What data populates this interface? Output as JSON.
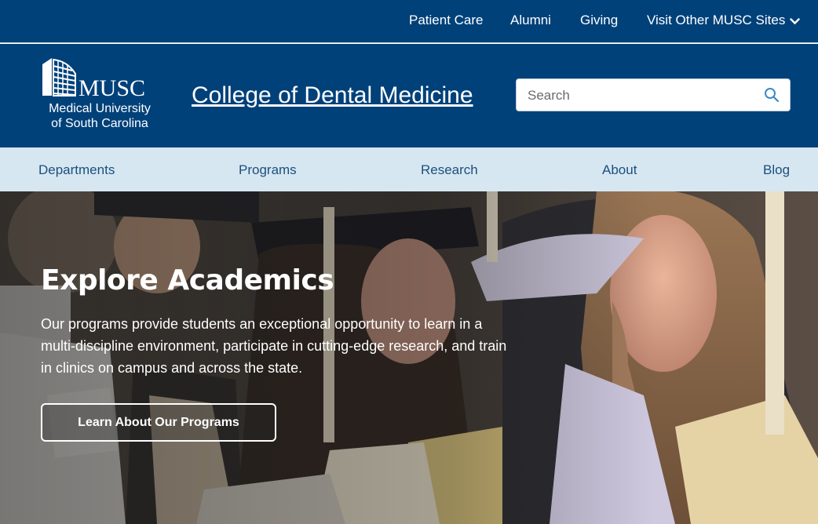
{
  "utility_nav": {
    "items": [
      {
        "label": "Patient Care"
      },
      {
        "label": "Alumni"
      },
      {
        "label": "Giving"
      },
      {
        "label": "Visit Other MUSC Sites"
      }
    ]
  },
  "header": {
    "logo": {
      "wordmark": "MUSC",
      "line1": "Medical University",
      "line2": "of South Carolina"
    },
    "site_title": "College of Dental Medicine",
    "search": {
      "placeholder": "Search",
      "value": ""
    }
  },
  "main_nav": {
    "items": [
      {
        "label": "Departments"
      },
      {
        "label": "Programs"
      },
      {
        "label": "Research"
      },
      {
        "label": "About"
      },
      {
        "label": "Blog"
      }
    ]
  },
  "hero": {
    "title": "Explore Academics",
    "text": "Our programs provide students an exceptional opportunity to learn in a multi-discipline environment, participate in cutting-edge research, and train in clinics on campus and across the state.",
    "cta_label": "Learn About Our Programs"
  },
  "colors": {
    "primary_blue": "#00417a",
    "nav_background": "#d6e7f2",
    "nav_text": "#1d4f7c",
    "search_icon": "#3a8bc4"
  },
  "icons": {
    "search": "search-icon",
    "dropdown": "chevron-down-icon",
    "logo": "musc-building-logo-icon"
  }
}
